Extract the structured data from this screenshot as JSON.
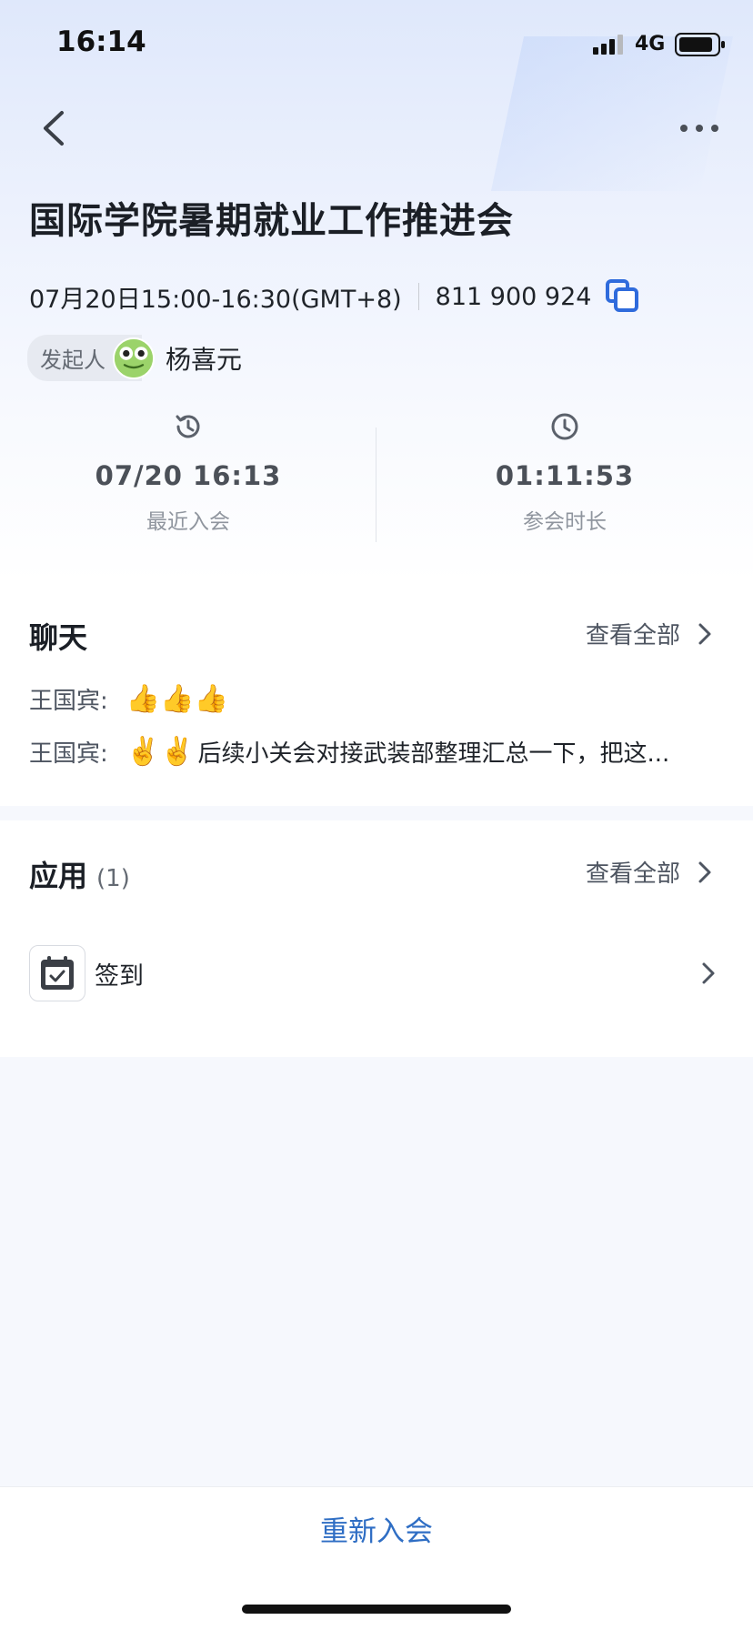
{
  "status_bar": {
    "time": "16:14",
    "network": "4G"
  },
  "meeting": {
    "title": "国际学院暑期就业工作推进会",
    "time_range": "07月20日15:00-16:30(GMT+8)",
    "meeting_id": "811 900 924",
    "initiator_label": "发起人",
    "initiator_name": "杨喜元"
  },
  "stats": [
    {
      "value": "07/20 16:13",
      "label": "最近入会",
      "icon": "history-icon"
    },
    {
      "value": "01:11:53",
      "label": "参会时长",
      "icon": "clock-icon"
    }
  ],
  "chat": {
    "title": "聊天",
    "view_all": "查看全部",
    "messages": [
      {
        "sender": "王国宾:",
        "emojis": "👍👍👍",
        "text": ""
      },
      {
        "sender": "王国宾:",
        "emojis": "✌️✌️",
        "text": "后续小关会对接武装部整理汇总一下，把这..."
      }
    ]
  },
  "apps": {
    "title": "应用",
    "count": "(1)",
    "view_all": "查看全部",
    "items": [
      {
        "label": "签到",
        "icon": "checkin-calendar-icon"
      }
    ]
  },
  "actions": {
    "rejoin": "重新入会"
  },
  "colors": {
    "accent": "#2f6ec4",
    "copy_icon": "#2f6bdc",
    "background": "#f6f8fd"
  }
}
